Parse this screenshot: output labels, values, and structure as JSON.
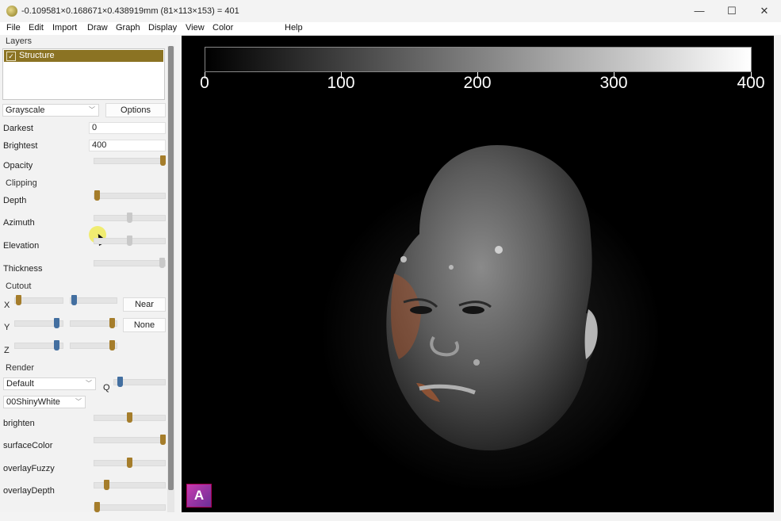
{
  "window": {
    "title": "-0.109581×0.168671×0.438919mm (81×113×153) = 401",
    "minimize_glyph": "—",
    "maximize_glyph": "☐",
    "close_glyph": "✕"
  },
  "menu": [
    "File",
    "Edit",
    "Import",
    "Draw",
    "Graph",
    "Display",
    "View",
    "Color",
    "Help"
  ],
  "panel": {
    "layers_label": "Layers",
    "layer": {
      "name": "Structure",
      "checked": true
    },
    "colormap": "Grayscale",
    "options_button": "Options",
    "darkest_label": "Darkest",
    "darkest_value": "0",
    "brightest_label": "Brightest",
    "brightest_value": "400",
    "opacity_label": "Opacity",
    "clipping_label": "Clipping",
    "depth_label": "Depth",
    "azimuth_label": "Azimuth",
    "elevation_label": "Elevation",
    "thickness_label": "Thickness",
    "cutout_label": "Cutout",
    "x_label": "X",
    "y_label": "Y",
    "z_label": "Z",
    "near_button": "Near",
    "none_button": "None",
    "render_label": "Render",
    "render_mode": "Default",
    "q_label": "Q",
    "shader": "00ShinyWhite",
    "brighten_label": "brighten",
    "surface_color_label": "surfaceColor",
    "overlay_fuzzy_label": "overlayFuzzy",
    "overlay_depth_label": "overlayDepth"
  },
  "viewport": {
    "colorbar_ticks": [
      "0",
      "100",
      "200",
      "300",
      "400"
    ],
    "orientation_letter": "A"
  },
  "colors": {
    "accent_gold": "#a57d2b",
    "accent_blue": "#436fa0",
    "layer_highlight": "#8b7323"
  }
}
